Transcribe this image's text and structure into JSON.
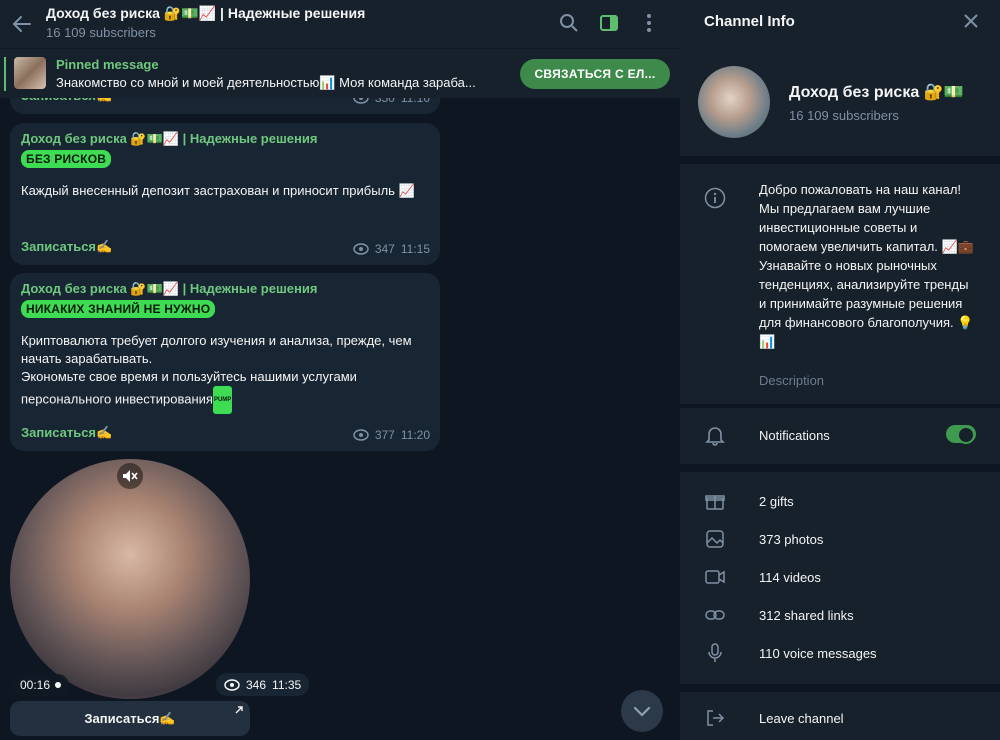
{
  "header": {
    "title": "Доход без риска 🔐💵📈 | Надежные решения",
    "subscribers": "16 109 subscribers"
  },
  "pinned": {
    "title": "Pinned message",
    "text": "Знакомство со мной и моей деятельностью📊 Моя команда зараба...",
    "button": "СВЯЗАТЬСЯ С ЕЛ..."
  },
  "messages": [
    {
      "link": "Записаться✍️",
      "views": "350",
      "time": "11:10"
    },
    {
      "author": "Доход без риска 🔐💵📈 | Надежные решения",
      "tag": "БЕЗ РИСКОВ",
      "text": "Каждый внесенный депозит застрахован и приносит прибыль 📈",
      "link": "Записаться✍️",
      "views": "347",
      "time": "11:15"
    },
    {
      "author": "Доход без риска 🔐💵📈 | Надежные решения",
      "tag": "НИКАКИХ ЗНАНИЙ НЕ НУЖНО",
      "text1": "Криптовалюта требует долгого изучения и анализа, прежде, чем начать зарабатывать.",
      "text2": "Экономьте свое время и пользуйтесь нашими услугами персонального инвестирования",
      "pump": "PUMP",
      "link": "Записаться✍️",
      "views": "377",
      "time": "11:20"
    }
  ],
  "video": {
    "duration": "00:16",
    "views": "346",
    "time": "11:35",
    "button": "Записаться✍️"
  },
  "info": {
    "title": "Channel Info",
    "name": "Доход без риска 🔐💵",
    "subscribers": "16 109 subscribers",
    "description": "Добро пожаловать на наш канал! Мы предлагаем вам лучшие инвестиционные советы и помогаем увеличить капитал. 📈💼 Узнавайте о новых рыночных тенденциях, анализируйте тренды и принимайте разумные решения для финансового благополучия. 💡📊",
    "description_label": "Description",
    "notifications": "Notifications",
    "notifications_on": true,
    "media": {
      "gifts": "2 gifts",
      "photos": "373 photos",
      "videos": "114 videos",
      "links": "312 shared links",
      "voice": "110 voice messages"
    },
    "leave": "Leave channel"
  }
}
